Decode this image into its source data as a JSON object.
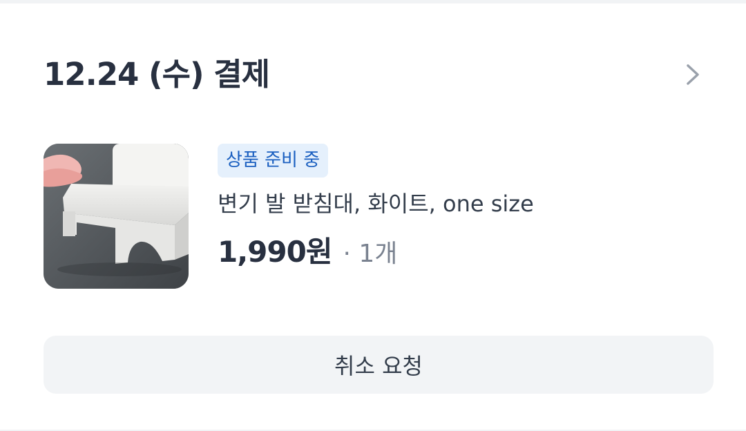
{
  "order": {
    "title": "12.24 (수) 결제",
    "chevron_icon": "chevron-right-icon"
  },
  "item": {
    "image_icon": "toilet-footstool-photo",
    "status_badge": "상품 준비 중",
    "name": "변기 발 받침대, 화이트, one size",
    "price": "1,990원",
    "quantity": "· 1개"
  },
  "actions": {
    "cancel_label": "취소 요청"
  },
  "colors": {
    "badge_bg": "#e5f0fc",
    "badge_text": "#1a5fc0",
    "title_text": "#283040",
    "button_bg": "#f2f4f6"
  }
}
